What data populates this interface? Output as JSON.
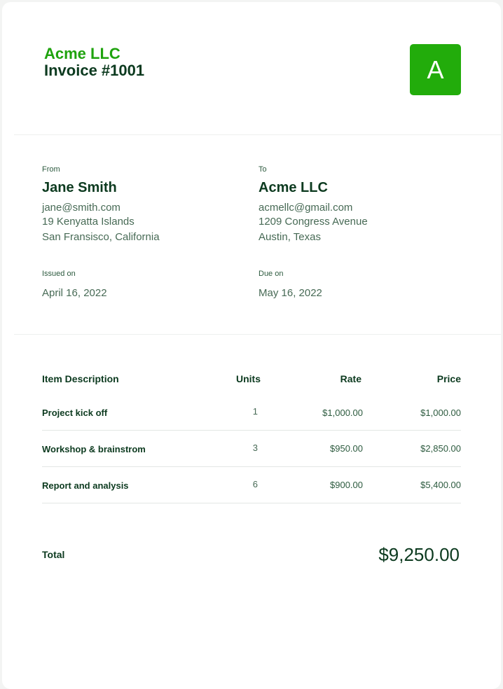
{
  "header": {
    "company": "Acme LLC",
    "title": "Invoice #1001",
    "logo_letter": "A",
    "brand_color": "#22ac0b"
  },
  "from": {
    "label": "From",
    "name": "Jane Smith",
    "email": "jane@smith.com",
    "address1": "19 Kenyatta Islands",
    "address2": "San Fransisco, California"
  },
  "to": {
    "label": "To",
    "name": "Acme LLC",
    "email": "acmellc@gmail.com",
    "address1": "1209 Congress Avenue",
    "address2": "Austin, Texas"
  },
  "dates": {
    "issued_label": "Issued on",
    "issued_value": "April 16, 2022",
    "due_label": "Due on",
    "due_value": "May 16, 2022"
  },
  "table": {
    "headers": {
      "description": "Item Description",
      "units": "Units",
      "rate": "Rate",
      "price": "Price"
    },
    "rows": [
      {
        "description": "Project kick off",
        "units": "1",
        "rate": "$1,000.00",
        "price": "$1,000.00"
      },
      {
        "description": "Workshop & brainstrom",
        "units": "3",
        "rate": "$950.00",
        "price": "$2,850.00"
      },
      {
        "description": "Report and analysis",
        "units": "6",
        "rate": "$900.00",
        "price": "$5,400.00"
      }
    ]
  },
  "total": {
    "label": "Total",
    "value": "$9,250.00"
  }
}
